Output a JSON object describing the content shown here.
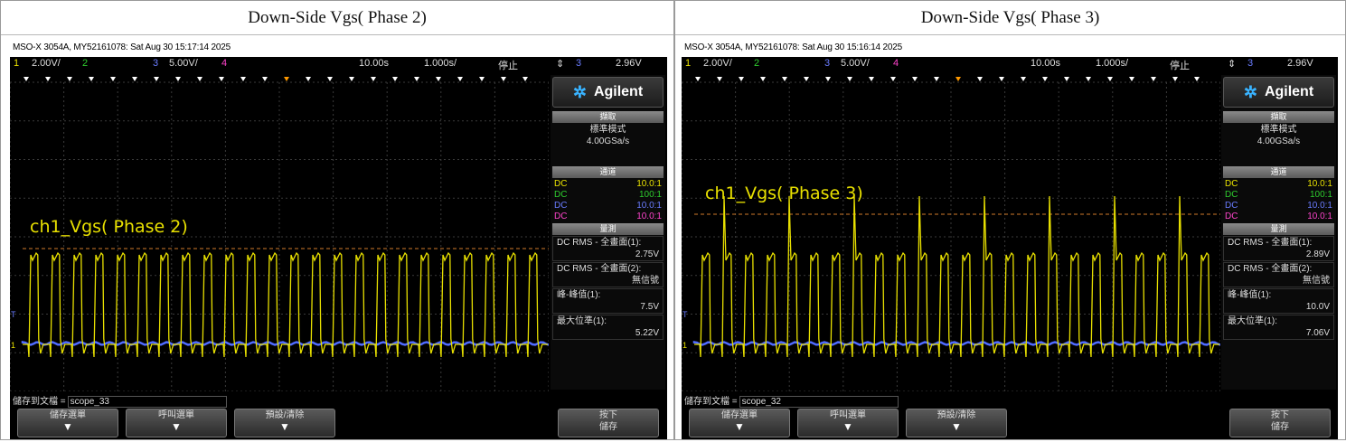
{
  "panels": [
    {
      "caption": "Down-Side Vgs( Phase 2)",
      "titlebar": "MSO-X 3054A, MY52161078: Sat Aug 30 15:17:14 2025",
      "ch1_scale": "2.00V/",
      "ch2_label": "2",
      "ch3_scale": "5.00V/",
      "ch4_label": "4",
      "time_pos": "10.00s",
      "timebase": "1.000s/",
      "run_state": "停止",
      "trig_channel": "3",
      "trig_level": "2.96V",
      "brand": "Agilent",
      "acq_header": "擷取",
      "acq_mode": "標準模式",
      "sample_rate": "4.00GSa/s",
      "chan_header": "通道",
      "channels": [
        {
          "coupling": "DC",
          "probe": "10.0:1",
          "color": "#e8e000"
        },
        {
          "coupling": "DC",
          "probe": "100:1",
          "color": "#2ecc2e"
        },
        {
          "coupling": "DC",
          "probe": "10.0:1",
          "color": "#6a7cff"
        },
        {
          "coupling": "DC",
          "probe": "10.0:1",
          "color": "#ff44cc"
        }
      ],
      "meas_header": "量測",
      "meas": [
        {
          "label": "DC RMS - 全畫面(1):",
          "value": "2.75V"
        },
        {
          "label": "DC RMS - 全畫面(2):",
          "value": "無信號"
        },
        {
          "label": "峰-峰值(1):",
          "value": "7.5V"
        },
        {
          "label": "最大位準(1):",
          "value": "5.22V"
        }
      ],
      "save_label": "儲存到文檔 =",
      "save_file": "scope_33",
      "buttons": [
        "儲存選單",
        "呼叫選單",
        "預設/清除"
      ],
      "press_button": [
        "按下",
        "儲存"
      ],
      "wave_label": "ch1_Vgs( Phase 2)",
      "pulses": 24,
      "spike_every": 0
    },
    {
      "caption": "Down-Side Vgs( Phase 3)",
      "titlebar": "MSO-X 3054A, MY52161078: Sat Aug 30 15:16:14 2025",
      "ch1_scale": "2.00V/",
      "ch2_label": "2",
      "ch3_scale": "5.00V/",
      "ch4_label": "4",
      "time_pos": "10.00s",
      "timebase": "1.000s/",
      "run_state": "停止",
      "trig_channel": "3",
      "trig_level": "2.96V",
      "brand": "Agilent",
      "acq_header": "擷取",
      "acq_mode": "標準模式",
      "sample_rate": "4.00GSa/s",
      "chan_header": "通道",
      "channels": [
        {
          "coupling": "DC",
          "probe": "10.0:1",
          "color": "#e8e000"
        },
        {
          "coupling": "DC",
          "probe": "100:1",
          "color": "#2ecc2e"
        },
        {
          "coupling": "DC",
          "probe": "10.0:1",
          "color": "#6a7cff"
        },
        {
          "coupling": "DC",
          "probe": "10.0:1",
          "color": "#ff44cc"
        }
      ],
      "meas_header": "量測",
      "meas": [
        {
          "label": "DC RMS - 全畫面(1):",
          "value": "2.89V"
        },
        {
          "label": "DC RMS - 全畫面(2):",
          "value": "無信號"
        },
        {
          "label": "峰-峰值(1):",
          "value": "10.0V"
        },
        {
          "label": "最大位準(1):",
          "value": "7.06V"
        }
      ],
      "save_label": "儲存到文檔 =",
      "save_file": "scope_32",
      "buttons": [
        "儲存選單",
        "呼叫選單",
        "預設/清除"
      ],
      "press_button": [
        "按下",
        "儲存"
      ],
      "wave_label": "ch1_Vgs( Phase 3)",
      "pulses": 24,
      "spike_every": 3
    }
  ]
}
